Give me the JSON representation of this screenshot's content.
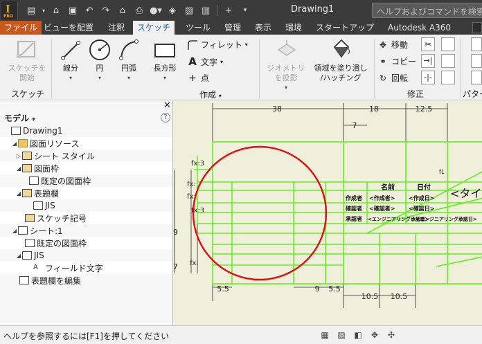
{
  "app": {
    "title": "Drawing1",
    "help_placeholder": "ヘルプおよびコマンドを検索",
    "logo_text": "PRO"
  },
  "menu": {
    "tabs": [
      "ファイル",
      "ビューを配置",
      "注釈",
      "スケッチ",
      "ツール",
      "管理",
      "表示",
      "環境",
      "スタートアップ",
      "Autodesk A360"
    ],
    "active": "スケッチ"
  },
  "ribbon": {
    "sketch_start": "スケッチを\n開始",
    "sketch_panel": "スケッチ",
    "line": "線分",
    "circle": "円",
    "arc": "円弧",
    "rectangle": "長方形",
    "fillet": "フィレット",
    "text": "文字",
    "point": "点",
    "create_panel": "作成",
    "project_geometry": "ジオメトリ\nを投影",
    "fill_region": "領域を塗り潰し\n/ハッチング",
    "move": "移動",
    "copy": "コピー",
    "rotate": "回転",
    "modify_panel": "修正",
    "pattern_panel": "パター"
  },
  "browser": {
    "header": "モデル",
    "items": [
      {
        "label": "Drawing1",
        "level": 0
      },
      {
        "label": "図面リソース",
        "level": 1
      },
      {
        "label": "シート スタイル",
        "level": 2
      },
      {
        "label": "図面枠",
        "level": 2
      },
      {
        "label": "既定の図面枠",
        "level": 3
      },
      {
        "label": "表題欄",
        "level": 2
      },
      {
        "label": "JIS",
        "level": 3
      },
      {
        "label": "スケッチ記号",
        "level": 2
      },
      {
        "label": "シート:1",
        "level": 1
      },
      {
        "label": "既定の図面枠",
        "level": 2
      },
      {
        "label": "JIS",
        "level": 2
      },
      {
        "label": "フィールド文字",
        "level": 3
      },
      {
        "label": "表題欄を編集",
        "level": 1
      }
    ]
  },
  "drawing": {
    "dim_38": "38",
    "dim_18": "18",
    "dim_12_5": "12.5",
    "dim_7": "7",
    "dim_5_5a": "5.5",
    "dim_9": "9",
    "dim_5_5b": "5.5",
    "dim_10_5a": "10.5",
    "dim_10_5b": "10.5",
    "dim_9_left": "9",
    "dim_7_left": "7",
    "fx": "fx:3",
    "fx2": "fx:",
    "fx3": "fx:3",
    "name_label": "名前",
    "date_label": "日付",
    "creator_label": "作成者",
    "creator_value": "<作成者>",
    "creator_date": "<作成日>",
    "checker_label": "確認者",
    "checker_value": "<確認者>",
    "checker_date": "<確認日>",
    "approver_label": "承認者",
    "approver_text": "<エンジニアリング承認者>",
    "approval_date": "<エンジニアリング承認日>",
    "title_text": "<タイ",
    "f1": "f1"
  },
  "status": {
    "message": "ヘルプを参照するには[F1]を押してください"
  },
  "colors": {
    "accent": "#1a64b4",
    "file_tab": "#c8581e",
    "sketch_line": "#66ee22",
    "circle": "#dd1111",
    "canvas": "#efefdc"
  }
}
